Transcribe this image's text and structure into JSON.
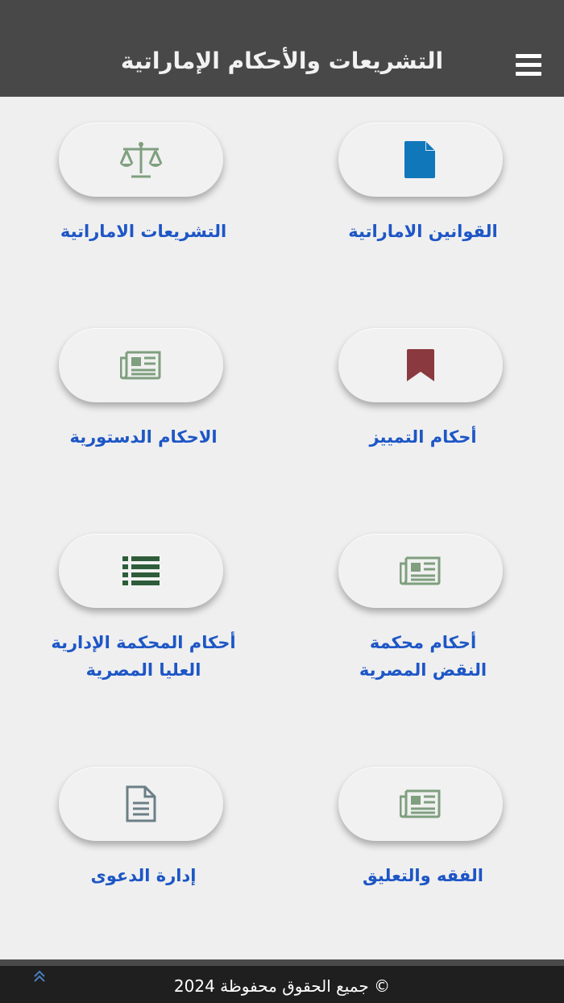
{
  "header": {
    "title": "التشريعات والأحكام الإماراتية",
    "menu_icon": "hamburger-menu-icon"
  },
  "tiles": [
    {
      "id": "uae-laws",
      "lines": [
        "القوانين الاماراتية"
      ],
      "icon": "file-icon",
      "color": "#1177bb"
    },
    {
      "id": "uae-legislation",
      "lines": [
        "التشريعات الاماراتية"
      ],
      "icon": "balance-scale-icon",
      "color": "#7f9f7f"
    },
    {
      "id": "cassation-rulings",
      "lines": [
        "أحكام التمييز"
      ],
      "icon": "bookmark-icon",
      "color": "#8a3a3e"
    },
    {
      "id": "constitutional-rulings",
      "lines": [
        "الاحكام الدستورية"
      ],
      "icon": "newspaper-icon",
      "color": "#7f9f7f"
    },
    {
      "id": "egyptian-cassation",
      "lines": [
        "أحكام محكمة",
        "النقض المصرية"
      ],
      "icon": "newspaper-icon",
      "color": "#7f9f7f"
    },
    {
      "id": "egyptian-admin-court",
      "lines": [
        "أحكام المحكمة الإدارية",
        "العليا المصرية"
      ],
      "icon": "list-icon",
      "color": "#2e5c3a"
    },
    {
      "id": "jurisprudence",
      "lines": [
        "الفقه والتعليق"
      ],
      "icon": "newspaper-icon",
      "color": "#7f9f7f"
    },
    {
      "id": "case-management",
      "lines": [
        "إدارة الدعوى"
      ],
      "icon": "document-icon",
      "color": "#6b7f86"
    }
  ],
  "footer": {
    "copyright": "جميع الحقوق محفوظة 2024 ©",
    "scroll_top_icon": "double-chevron-up-icon",
    "scroll_top_color": "#4a7fc0"
  }
}
